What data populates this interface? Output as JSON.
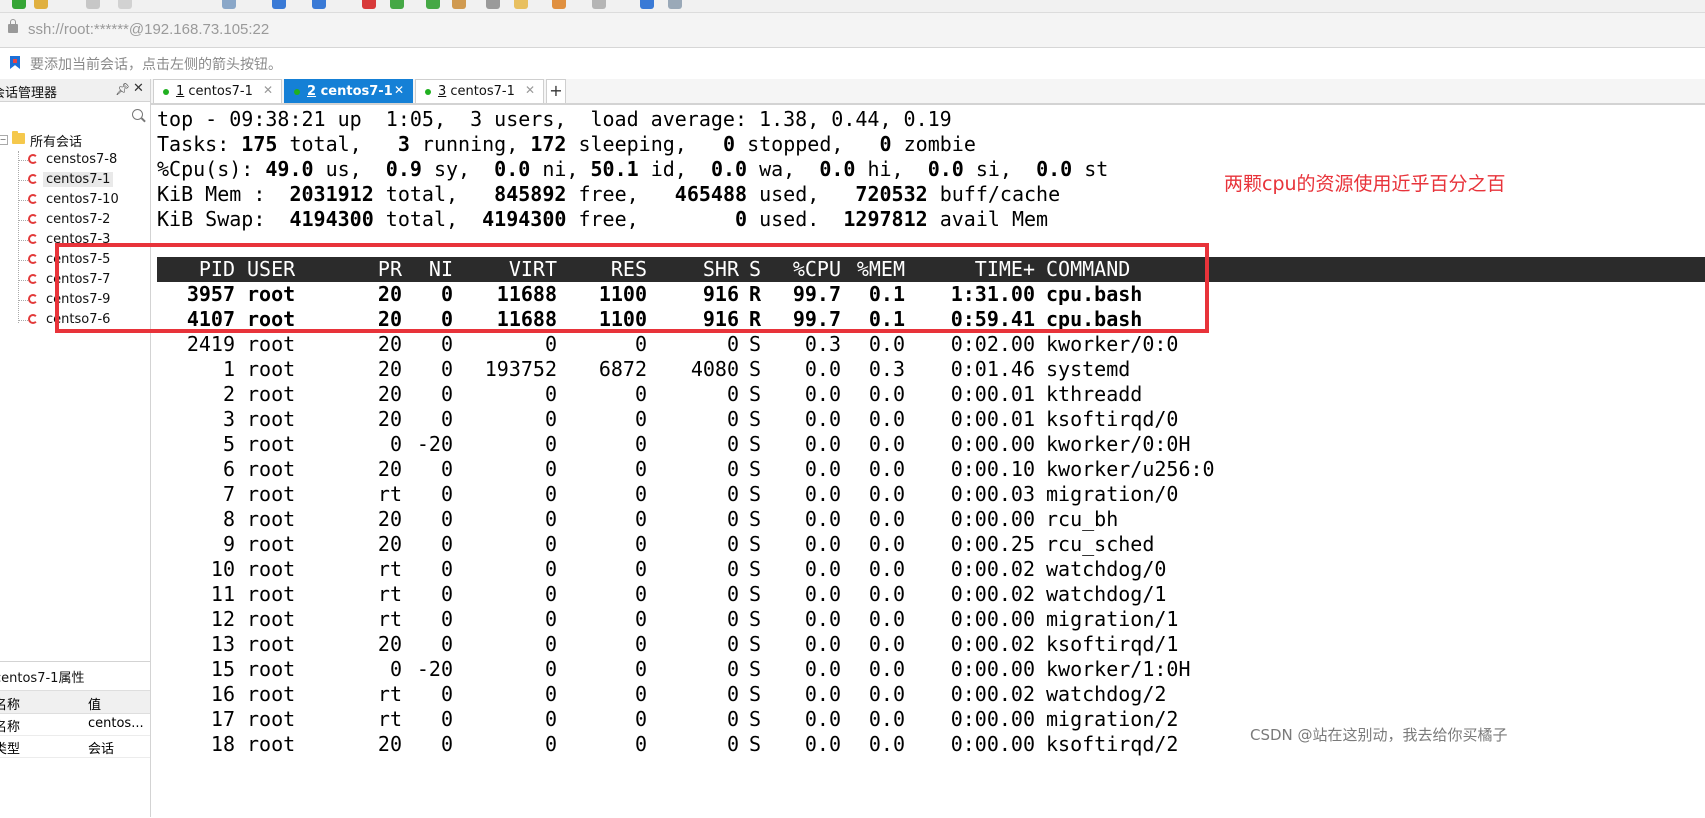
{
  "window": {
    "address": "ssh://root:******@192.168.73.105:22",
    "hint": "要添加当前会话，点击左侧的箭头按钮。"
  },
  "sidebar": {
    "title": "会话管理器",
    "root_label": "所有会话",
    "items": [
      {
        "label": "censtos7-8"
      },
      {
        "label": "centos7-1"
      },
      {
        "label": "centos7-10"
      },
      {
        "label": "centos7-2"
      },
      {
        "label": "centos7-3"
      },
      {
        "label": "centos7-5"
      },
      {
        "label": "centos7-7"
      },
      {
        "label": "centos7-9"
      },
      {
        "label": "centso7-6"
      }
    ],
    "properties": {
      "title": "centos7-1属性",
      "header_name": "名称",
      "header_value": "值",
      "rows": [
        {
          "key": "名称",
          "value": "centos..."
        },
        {
          "key": "类型",
          "value": "会话"
        }
      ]
    }
  },
  "tabs": [
    {
      "num": "1",
      "label": " centos7-1"
    },
    {
      "num": "2",
      "label": " centos7-1"
    },
    {
      "num": "3",
      "label": " centos7-1"
    }
  ],
  "tab_add_label": "+",
  "terminal": {
    "summary": {
      "line1": "top - 09:38:21 up  1:05,  3 users,  load average: 1.38, 0.44, 0.19",
      "tasks_prefix": "Tasks: ",
      "tasks_total": "175",
      "tasks_total_lbl": " total,   ",
      "tasks_running": "3",
      "tasks_running_lbl": " running, ",
      "tasks_sleeping": "172",
      "tasks_sleeping_lbl": " sleeping,   ",
      "tasks_stopped": "0",
      "tasks_stopped_lbl": " stopped,   ",
      "tasks_zombie": "0",
      "tasks_zombie_lbl": " zombie",
      "cpu_prefix": "%Cpu(s): ",
      "cpu_us": "49.0",
      "cpu_us_lbl": " us,  ",
      "cpu_sy": "0.9",
      "cpu_sy_lbl": " sy,  ",
      "cpu_ni": "0.0",
      "cpu_ni_lbl": " ni, ",
      "cpu_id": "50.1",
      "cpu_id_lbl": " id,  ",
      "cpu_wa": "0.0",
      "cpu_wa_lbl": " wa,  ",
      "cpu_hi": "0.0",
      "cpu_hi_lbl": " hi,  ",
      "cpu_si": "0.0",
      "cpu_si_lbl": " si,  ",
      "cpu_st": "0.0",
      "cpu_st_lbl": " st",
      "mem_prefix": "KiB Mem :  ",
      "mem_total": "2031912",
      "mem_total_lbl": " total,   ",
      "mem_free": "845892",
      "mem_free_lbl": " free,   ",
      "mem_used": "465488",
      "mem_used_lbl": " used,   ",
      "mem_cache": "720532",
      "mem_cache_lbl": " buff/cache",
      "swap_prefix": "KiB Swap:  ",
      "swap_total": "4194300",
      "swap_total_lbl": " total,  ",
      "swap_free": "4194300",
      "swap_free_lbl": " free,        ",
      "swap_used": "0",
      "swap_used_lbl": " used.  ",
      "swap_avail": "1297812",
      "swap_avail_lbl": " avail Mem"
    },
    "headers": [
      "PID",
      "USER",
      "PR",
      "NI",
      "VIRT",
      "RES",
      "SHR",
      "S",
      "%CPU",
      "%MEM",
      "TIME+",
      "COMMAND"
    ],
    "processes": [
      [
        "3957",
        "root",
        "20",
        "0",
        "11688",
        "1100",
        "916",
        "R",
        "99.7",
        "0.1",
        "1:31.00",
        "cpu.bash"
      ],
      [
        "4107",
        "root",
        "20",
        "0",
        "11688",
        "1100",
        "916",
        "R",
        "99.7",
        "0.1",
        "0:59.41",
        "cpu.bash"
      ],
      [
        "2419",
        "root",
        "20",
        "0",
        "0",
        "0",
        "0",
        "S",
        "0.3",
        "0.0",
        "0:02.00",
        "kworker/0:0"
      ],
      [
        "1",
        "root",
        "20",
        "0",
        "193752",
        "6872",
        "4080",
        "S",
        "0.0",
        "0.3",
        "0:01.46",
        "systemd"
      ],
      [
        "2",
        "root",
        "20",
        "0",
        "0",
        "0",
        "0",
        "S",
        "0.0",
        "0.0",
        "0:00.01",
        "kthreadd"
      ],
      [
        "3",
        "root",
        "20",
        "0",
        "0",
        "0",
        "0",
        "S",
        "0.0",
        "0.0",
        "0:00.01",
        "ksoftirqd/0"
      ],
      [
        "5",
        "root",
        "0",
        "-20",
        "0",
        "0",
        "0",
        "S",
        "0.0",
        "0.0",
        "0:00.00",
        "kworker/0:0H"
      ],
      [
        "6",
        "root",
        "20",
        "0",
        "0",
        "0",
        "0",
        "S",
        "0.0",
        "0.0",
        "0:00.10",
        "kworker/u256:0"
      ],
      [
        "7",
        "root",
        "rt",
        "0",
        "0",
        "0",
        "0",
        "S",
        "0.0",
        "0.0",
        "0:00.03",
        "migration/0"
      ],
      [
        "8",
        "root",
        "20",
        "0",
        "0",
        "0",
        "0",
        "S",
        "0.0",
        "0.0",
        "0:00.00",
        "rcu_bh"
      ],
      [
        "9",
        "root",
        "20",
        "0",
        "0",
        "0",
        "0",
        "S",
        "0.0",
        "0.0",
        "0:00.25",
        "rcu_sched"
      ],
      [
        "10",
        "root",
        "rt",
        "0",
        "0",
        "0",
        "0",
        "S",
        "0.0",
        "0.0",
        "0:00.02",
        "watchdog/0"
      ],
      [
        "11",
        "root",
        "rt",
        "0",
        "0",
        "0",
        "0",
        "S",
        "0.0",
        "0.0",
        "0:00.02",
        "watchdog/1"
      ],
      [
        "12",
        "root",
        "rt",
        "0",
        "0",
        "0",
        "0",
        "S",
        "0.0",
        "0.0",
        "0:00.00",
        "migration/1"
      ],
      [
        "13",
        "root",
        "20",
        "0",
        "0",
        "0",
        "0",
        "S",
        "0.0",
        "0.0",
        "0:00.02",
        "ksoftirqd/1"
      ],
      [
        "15",
        "root",
        "0",
        "-20",
        "0",
        "0",
        "0",
        "S",
        "0.0",
        "0.0",
        "0:00.00",
        "kworker/1:0H"
      ],
      [
        "16",
        "root",
        "rt",
        "0",
        "0",
        "0",
        "0",
        "S",
        "0.0",
        "0.0",
        "0:00.02",
        "watchdog/2"
      ],
      [
        "17",
        "root",
        "rt",
        "0",
        "0",
        "0",
        "0",
        "S",
        "0.0",
        "0.0",
        "0:00.00",
        "migration/2"
      ],
      [
        "18",
        "root",
        "20",
        "0",
        "0",
        "0",
        "0",
        "S",
        "0.0",
        "0.0",
        "0:00.00",
        "ksoftirqd/2"
      ]
    ]
  },
  "annotation": "两颗cpu的资源使用近乎百分之百",
  "watermark": "CSDN @站在这别动，我去给你买橘子",
  "colors": {
    "accent": "#1580d6",
    "annotation": "#e8333a",
    "header_bg": "#2b2b2b",
    "session_dot": "#20b020"
  }
}
